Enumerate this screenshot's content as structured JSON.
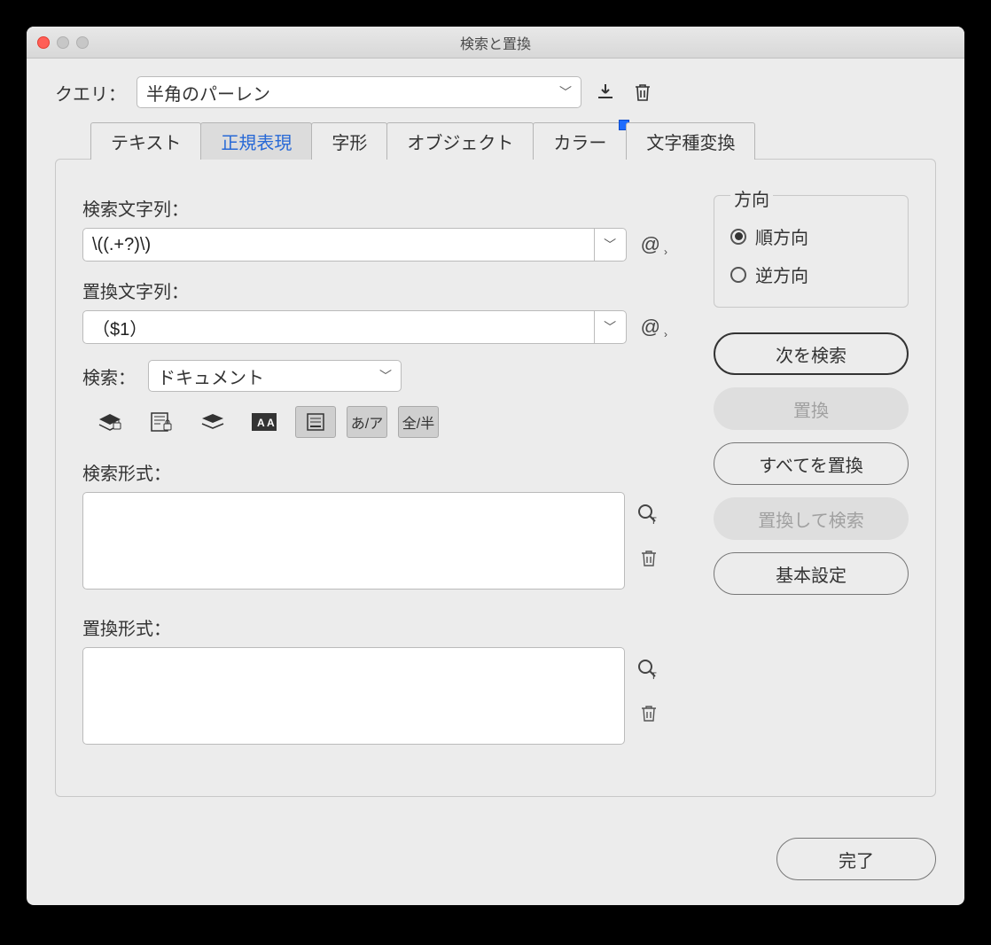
{
  "window": {
    "title": "検索と置換"
  },
  "query": {
    "label": "クエリ：",
    "value": "半角のパーレン"
  },
  "tabs": [
    {
      "label": "テキスト"
    },
    {
      "label": "正規表現",
      "active": true
    },
    {
      "label": "字形"
    },
    {
      "label": "オブジェクト"
    },
    {
      "label": "カラー",
      "badge": true
    },
    {
      "label": "文字種変換"
    }
  ],
  "find": {
    "label": "検索文字列：",
    "value": "\\((.+?)\\)"
  },
  "replace": {
    "label": "置換文字列：",
    "value": "（$1）"
  },
  "scope": {
    "label": "検索：",
    "value": "ドキュメント"
  },
  "options": {
    "kana": "あ/ア",
    "width": "全/半"
  },
  "findFormat": {
    "label": "検索形式："
  },
  "replaceFormat": {
    "label": "置換形式："
  },
  "direction": {
    "legend": "方向",
    "forward": "順方向",
    "backward": "逆方向",
    "selected": "forward"
  },
  "buttons": {
    "findNext": "次を検索",
    "replace": "置換",
    "replaceAll": "すべてを置換",
    "replaceFind": "置換して検索",
    "settings": "基本設定",
    "done": "完了"
  }
}
